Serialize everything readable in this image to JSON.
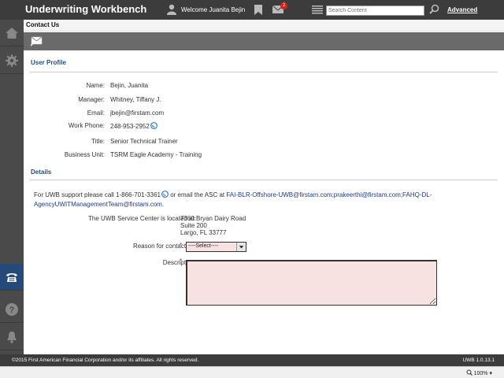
{
  "header": {
    "app_title": "Underwriting Workbench",
    "welcome": "Welcome Juanita Bejin",
    "notification_count": "2",
    "search_placeholder": "Search Content",
    "advanced_label": "Advanced"
  },
  "page": {
    "title": "Contact Us"
  },
  "sidebar": {
    "items": [
      {
        "icon": "home-icon"
      },
      {
        "icon": "gear-icon"
      },
      {
        "icon": "phone-icon",
        "active": true
      },
      {
        "icon": "help-icon"
      },
      {
        "icon": "bell-icon"
      }
    ]
  },
  "user_profile": {
    "section_title": "User Profile",
    "fields": [
      {
        "label": "Name:",
        "value": "Bejin, Juanita"
      },
      {
        "label": "Manager:",
        "value": "Whitney, Tiffany J."
      },
      {
        "label": "Email:",
        "value": "jbejin@firstam.com"
      },
      {
        "label": "Work Phone:",
        "value": "248-953-2952"
      },
      {
        "label": "Title:",
        "value": "Senior Technical Trainer"
      },
      {
        "label": "Business Unit:",
        "value": "TSRM Eagle Academy - Training"
      }
    ]
  },
  "details": {
    "section_title": "Details",
    "support_prefix": "For UWB support please call 1-866-701-3361",
    "support_middle": " or email the ASC at ",
    "support_emails": "FAI-BLR-Offshore-UWB@firstam.com;prakeerthi@firstam.com;FAHQ-DL-AgencyUWITManagementTeam@firstam.com",
    "support_suffix": ".",
    "location_label": "The UWB Service Center is located at:",
    "address": [
      "7360 Bryan Dairy Road",
      "Suite 200",
      "Largo, FL 33777"
    ],
    "reason_label": "Reason for contacting:",
    "reason_selected": "----Select----",
    "description_label": "Description:",
    "required_marker": "*"
  },
  "footer": {
    "copyright": "©2015 First American Financial Corporation and/or its affiliates. All rights reserved.",
    "version": "UWB 1.0.13.1"
  },
  "statusbar": {
    "zoom": "100%"
  },
  "colors": {
    "topbar": "#3c3c3c",
    "sidebar": "#4a4a4a",
    "active_nav": "#234a78",
    "section_title": "#1f4e79",
    "required_field_bg": "#f7e1e1",
    "badge": "#d9221b"
  }
}
